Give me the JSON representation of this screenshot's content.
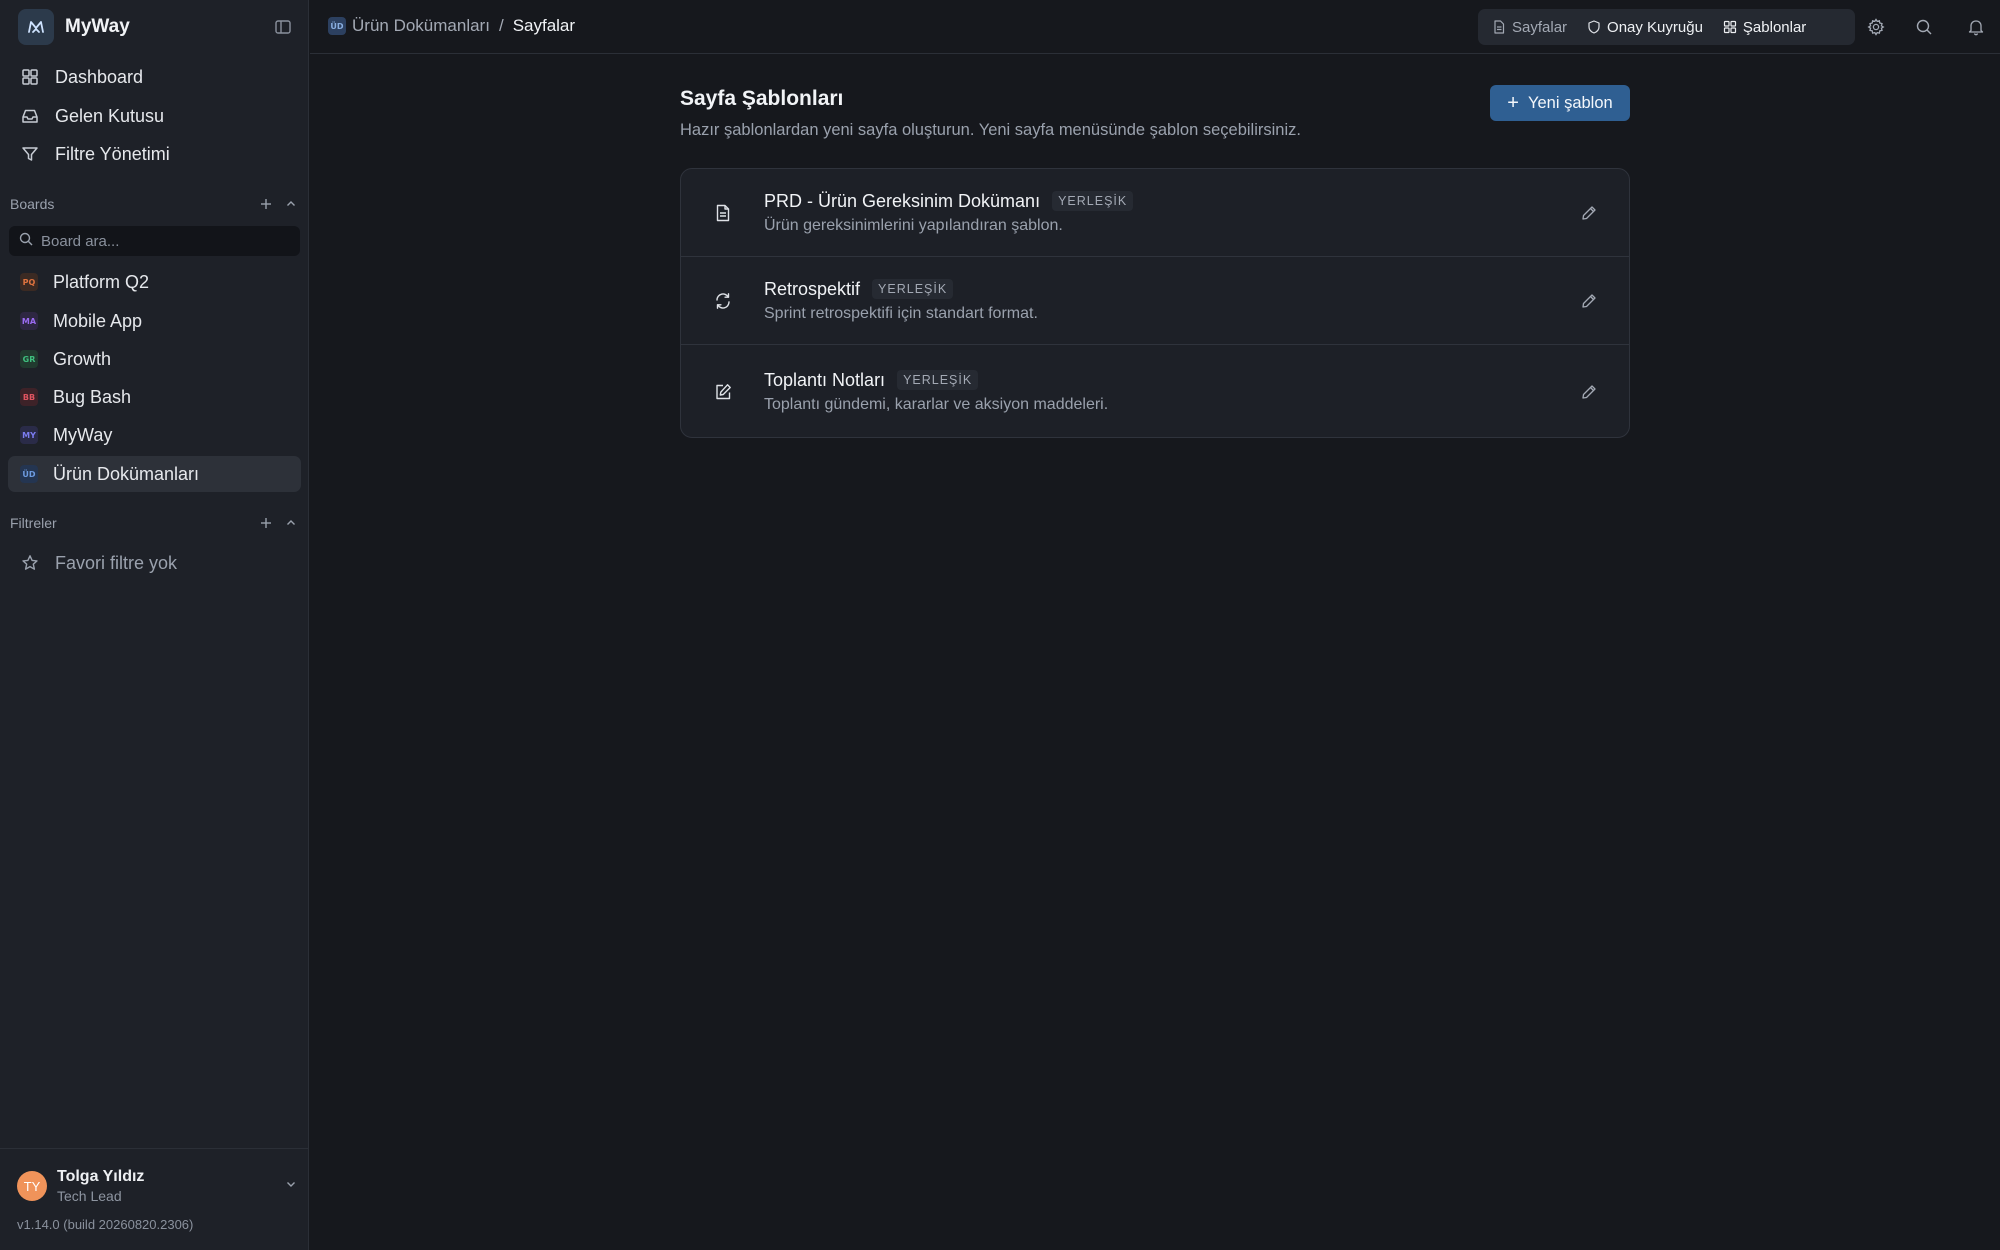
{
  "app": {
    "name": "MyWay"
  },
  "nav": {
    "dashboard": "Dashboard",
    "inbox": "Gelen Kutusu",
    "filters": "Filtre Yönetimi"
  },
  "boards": {
    "heading": "Boards",
    "search_placeholder": "Board ara...",
    "items": [
      {
        "badge": "PQ",
        "label": "Platform Q2",
        "color": "#e0733f",
        "bg": "#3b2a23"
      },
      {
        "badge": "MA",
        "label": "Mobile App",
        "color": "#9a6bf0",
        "bg": "#2e2742"
      },
      {
        "badge": "GR",
        "label": "Growth",
        "color": "#3fbf7f",
        "bg": "#213a2f"
      },
      {
        "badge": "BB",
        "label": "Bug Bash",
        "color": "#e05561",
        "bg": "#3d2228"
      },
      {
        "badge": "MY",
        "label": "MyWay",
        "color": "#7b7cf0",
        "bg": "#2a2b48"
      },
      {
        "badge": "ÜD",
        "label": "Ürün Dokümanları",
        "color": "#6d9be0",
        "bg": "#243551"
      }
    ]
  },
  "filters": {
    "heading": "Filtreler",
    "empty": "Favori filtre yok"
  },
  "user": {
    "initials": "TY",
    "name": "Tolga Yıldız",
    "role": "Tech Lead",
    "version": "v1.14.0 (build 20260820.2306)"
  },
  "breadcrumb": {
    "badge": "ÜD",
    "parent": "Ürün Dokümanları",
    "separator": "/",
    "current": "Sayfalar"
  },
  "tabs": {
    "pages": "Sayfalar",
    "approval": "Onay Kuyruğu",
    "templates": "Şablonlar"
  },
  "main": {
    "title": "Sayfa Şablonları",
    "subtitle": "Hazır şablonlardan yeni sayfa oluşturun. Yeni sayfa menüsünde şablon seçebilirsiniz.",
    "new_button": "Yeni şablon",
    "new_button_icon": "+",
    "templates": [
      {
        "icon": "document-icon",
        "title": "PRD - Ürün Gereksinim Dokümanı",
        "tag": "YERLEŞİK",
        "desc": "Ürün gereksinimlerini yapılandıran şablon."
      },
      {
        "icon": "refresh-icon",
        "title": "Retrospektif",
        "tag": "YERLEŞİK",
        "desc": "Sprint retrospektifi için standart format."
      },
      {
        "icon": "edit-square-icon",
        "title": "Toplantı Notları",
        "tag": "YERLEŞİK",
        "desc": "Toplantı gündemi, kararlar ve aksiyon maddeleri."
      }
    ]
  }
}
